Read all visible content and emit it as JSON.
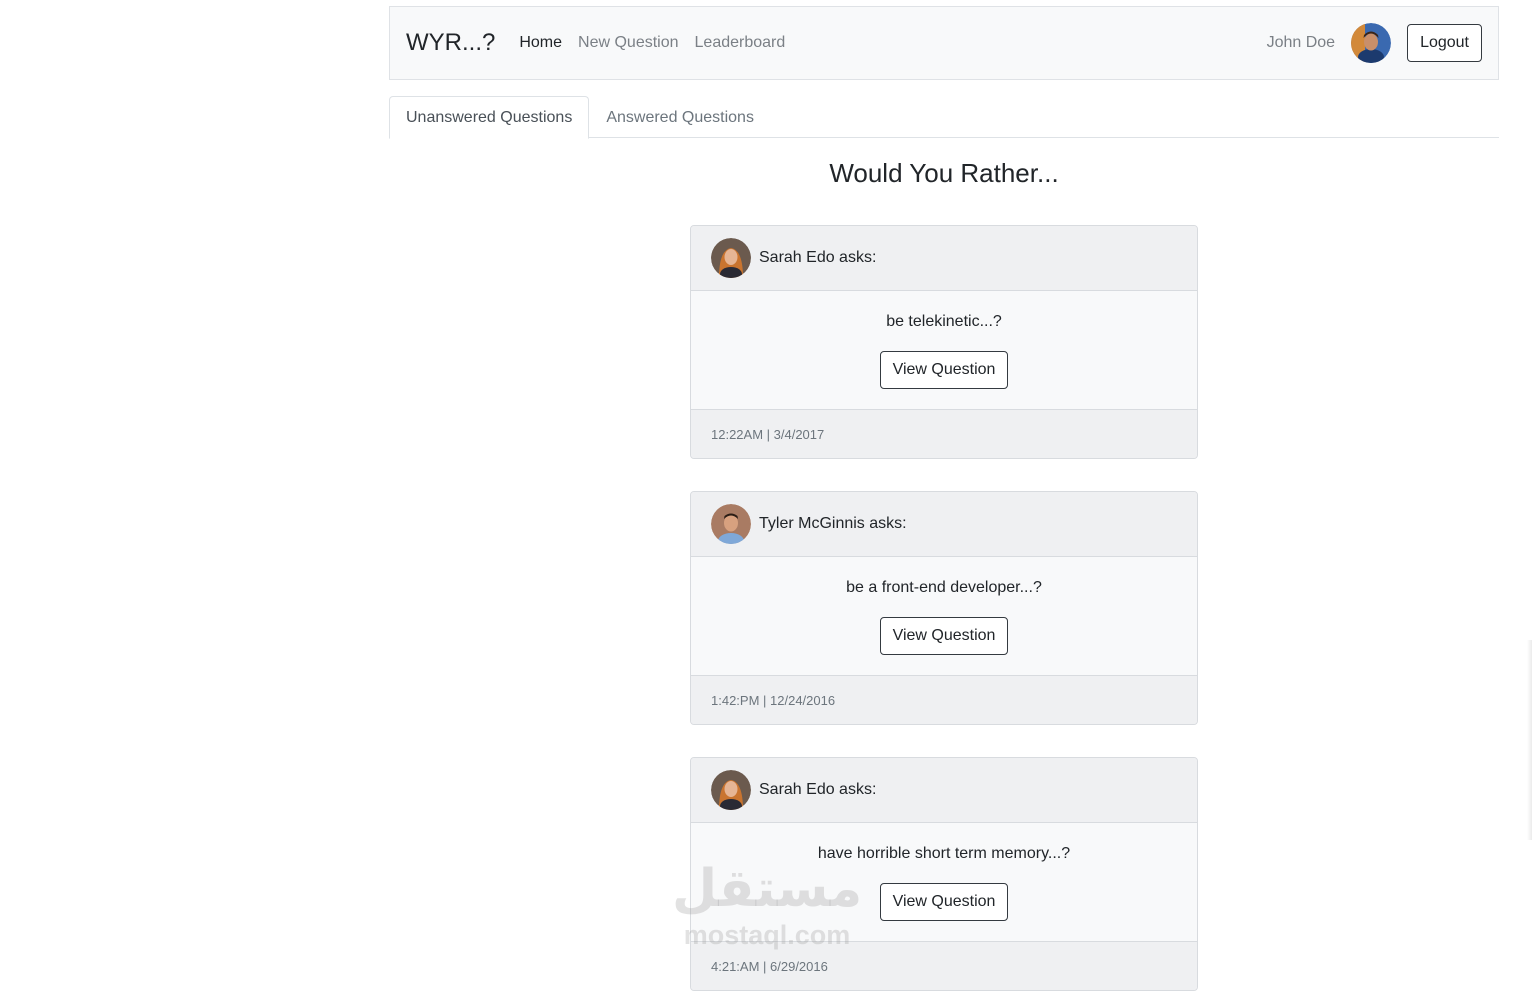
{
  "navbar": {
    "brand": "WYR...?",
    "links": [
      {
        "label": "Home",
        "active": true
      },
      {
        "label": "New Question",
        "active": false
      },
      {
        "label": "Leaderboard",
        "active": false
      }
    ],
    "user_name": "John Doe",
    "logout_label": "Logout"
  },
  "tabs": [
    {
      "label": "Unanswered Questions",
      "active": true
    },
    {
      "label": "Answered Questions",
      "active": false
    }
  ],
  "heading": "Would You Rather...",
  "questions": [
    {
      "asker": "Sarah Edo asks:",
      "text": "be telekinetic...?",
      "button": "View Question",
      "timestamp": "12:22AM | 3/4/2017"
    },
    {
      "asker": "Tyler McGinnis asks:",
      "text": "be a front-end developer...?",
      "button": "View Question",
      "timestamp": "1:42:PM | 12/24/2016"
    },
    {
      "asker": "Sarah Edo asks:",
      "text": "have horrible short term memory...?",
      "button": "View Question",
      "timestamp": "4:21:AM | 6/29/2016"
    }
  ],
  "watermark": {
    "arabic": "مستقل",
    "latin": "mostaql.com"
  },
  "colors": {
    "navbar_bg": "#f8f9fa",
    "card_header_bg": "#eff0f2",
    "muted_text": "#6c757d",
    "button_border": "#343a40"
  }
}
